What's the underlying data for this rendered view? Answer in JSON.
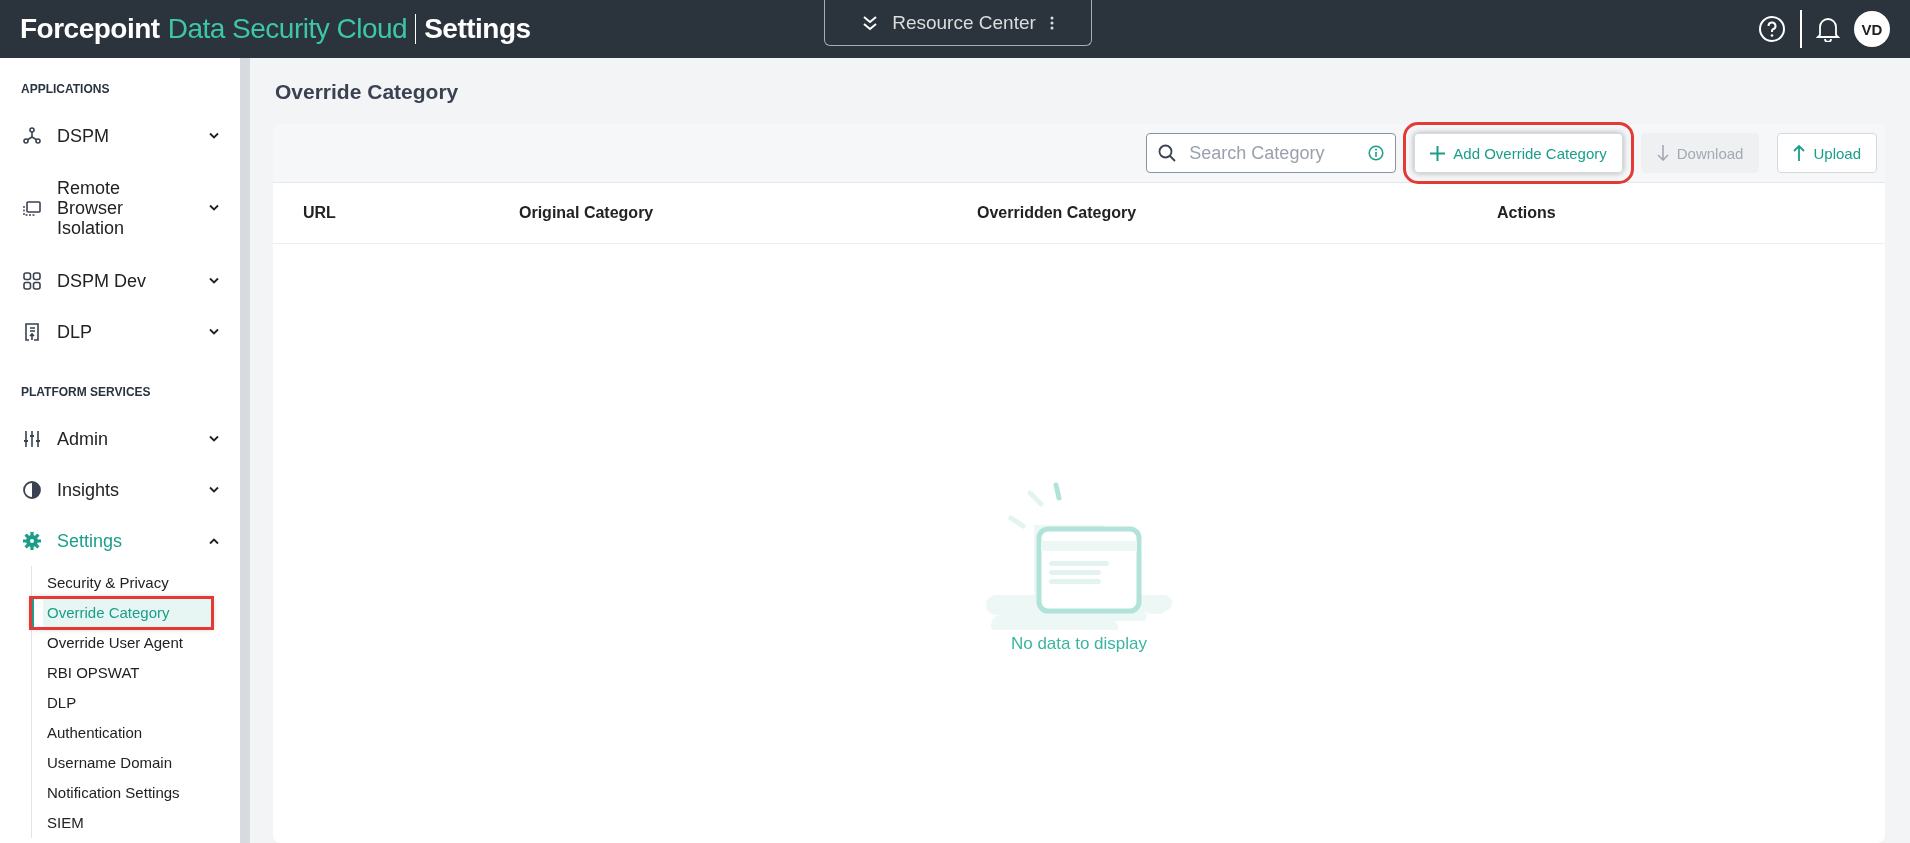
{
  "header": {
    "brand": "Forcepoint",
    "product": "Data Security Cloud",
    "section": "Settings",
    "resource_center": "Resource Center",
    "avatar": "VD"
  },
  "sidebar": {
    "groups": [
      {
        "heading": "APPLICATIONS",
        "items": [
          {
            "label": "DSPM",
            "expanded": false
          },
          {
            "label": "Remote Browser Isolation",
            "expanded": false
          },
          {
            "label": "DSPM Dev",
            "expanded": false
          },
          {
            "label": "DLP",
            "expanded": false
          }
        ]
      },
      {
        "heading": "PLATFORM SERVICES",
        "items": [
          {
            "label": "Admin",
            "expanded": false
          },
          {
            "label": "Insights",
            "expanded": false
          },
          {
            "label": "Settings",
            "expanded": true,
            "children": [
              {
                "label": "Security & Privacy",
                "selected": false,
                "highlighted": false
              },
              {
                "label": "Override Category",
                "selected": true,
                "highlighted": true
              },
              {
                "label": "Override User Agent",
                "selected": false,
                "highlighted": false
              },
              {
                "label": "RBI OPSWAT",
                "selected": false,
                "highlighted": false
              },
              {
                "label": "DLP",
                "selected": false,
                "highlighted": false
              },
              {
                "label": "Authentication",
                "selected": false,
                "highlighted": false
              },
              {
                "label": "Username Domain",
                "selected": false,
                "highlighted": false
              },
              {
                "label": "Notification Settings",
                "selected": false,
                "highlighted": false
              },
              {
                "label": "SIEM",
                "selected": false,
                "highlighted": false
              }
            ]
          }
        ]
      }
    ]
  },
  "page": {
    "title": "Override Category",
    "search": {
      "placeholder": "Search Category"
    },
    "buttons": [
      {
        "kind": "add",
        "label": "Add Override Category",
        "disabled": false,
        "highlighted": true
      },
      {
        "kind": "download",
        "label": "Download",
        "disabled": true,
        "highlighted": false
      },
      {
        "kind": "upload",
        "label": "Upload",
        "disabled": false,
        "highlighted": false
      }
    ],
    "table": {
      "columns": [
        "URL",
        "Original Category",
        "Overridden Category",
        "Actions"
      ],
      "empty_text": "No data to display"
    }
  }
}
